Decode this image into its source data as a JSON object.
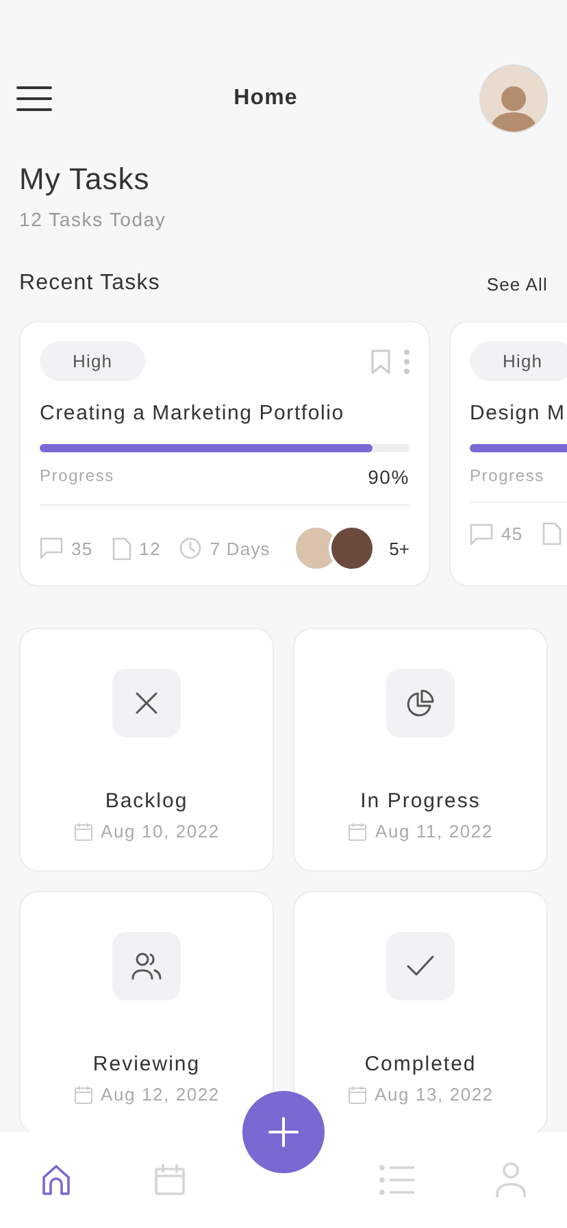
{
  "header": {
    "title": "Home"
  },
  "summary": {
    "title": "My Tasks",
    "subtitle": "12 Tasks Today"
  },
  "recent": {
    "title": "Recent Tasks",
    "action": "See All"
  },
  "tasks": [
    {
      "priority": "High",
      "title": "Creating a Marketing Portfolio",
      "level": 0.9,
      "progress_label": "Progress",
      "percent": "90%",
      "comments": "35",
      "files": "12",
      "due": "7 Days",
      "members_more": "5+"
    },
    {
      "priority": "High",
      "title": "Design M",
      "progress_label": "Progress",
      "comments": "45"
    }
  ],
  "statuses": [
    {
      "kind": "backlog",
      "label": "Backlog",
      "date": "Aug 10, 2022"
    },
    {
      "kind": "progress",
      "label": "In Progress",
      "date": "Aug 11, 2022"
    },
    {
      "kind": "review",
      "label": "Reviewing",
      "date": "Aug 12, 2022"
    },
    {
      "kind": "done",
      "label": "Completed",
      "date": "Aug 13, 2022"
    }
  ],
  "nav": [
    {
      "kind": "home",
      "selected": true
    },
    {
      "kind": "calendar",
      "selected": false
    },
    {
      "kind": "list",
      "selected": false
    },
    {
      "kind": "profile",
      "selected": false
    }
  ]
}
